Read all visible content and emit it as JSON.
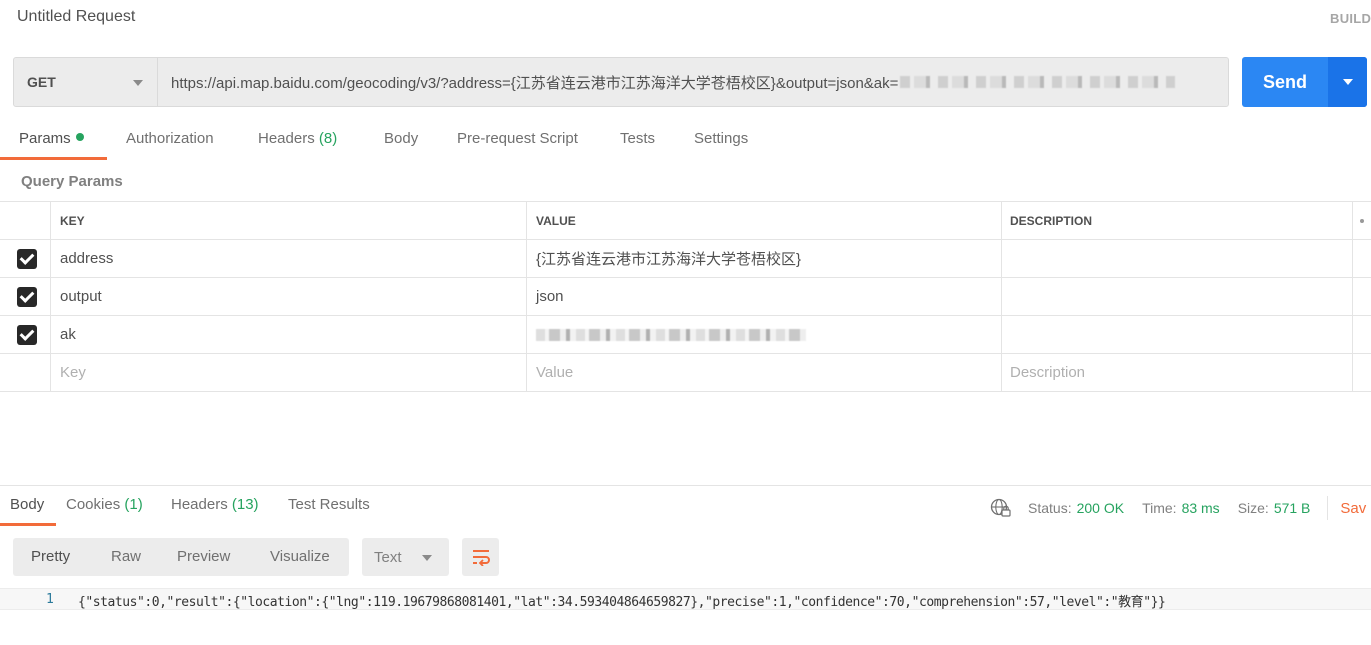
{
  "request": {
    "title": "Untitled Request",
    "build_label": "BUILD",
    "method": "GET",
    "url_visible": "https://api.map.baidu.com/geocoding/v3/?address={江苏省连云港市江苏海洋大学苍梧校区}&output=json&ak=",
    "url_redacted_suffix": "[redacted]",
    "send_label": "Send"
  },
  "request_tabs": [
    {
      "label": "Params",
      "active": true,
      "indicator": "green-dot"
    },
    {
      "label": "Authorization"
    },
    {
      "label": "Headers",
      "count": "(8)"
    },
    {
      "label": "Body"
    },
    {
      "label": "Pre-request Script"
    },
    {
      "label": "Tests"
    },
    {
      "label": "Settings"
    }
  ],
  "query_params": {
    "section_label": "Query Params",
    "columns": [
      "KEY",
      "VALUE",
      "DESCRIPTION"
    ],
    "rows": [
      {
        "checked": true,
        "key": "address",
        "value": "{江苏省连云港市江苏海洋大学苍梧校区}",
        "description": ""
      },
      {
        "checked": true,
        "key": "output",
        "value": "json",
        "description": ""
      },
      {
        "checked": true,
        "key": "ak",
        "value": "[redacted]",
        "description": ""
      }
    ],
    "placeholders": {
      "key": "Key",
      "value": "Value",
      "description": "Description"
    }
  },
  "response_tabs": [
    {
      "label": "Body",
      "active": true
    },
    {
      "label": "Cookies",
      "count": "(1)"
    },
    {
      "label": "Headers",
      "count": "(13)"
    },
    {
      "label": "Test Results"
    }
  ],
  "response_meta": {
    "status_label": "Status:",
    "status_value": "200 OK",
    "time_label": "Time:",
    "time_value": "83 ms",
    "size_label": "Size:",
    "size_value": "571 B",
    "save_label": "Sav"
  },
  "view_modes": [
    {
      "label": "Pretty",
      "active": true
    },
    {
      "label": "Raw"
    },
    {
      "label": "Preview"
    },
    {
      "label": "Visualize"
    }
  ],
  "format": "Text",
  "response_body": {
    "line_number": "1",
    "text": "{\"status\":0,\"result\":{\"location\":{\"lng\":119.19679868081401,\"lat\":34.593404864659827},\"precise\":1,\"confidence\":70,\"comprehension\":57,\"level\":\"教育\"}}"
  },
  "colors": {
    "accent_orange": "#f26b3a",
    "send_blue": "#2b87f3",
    "success_green": "#26a35f"
  }
}
